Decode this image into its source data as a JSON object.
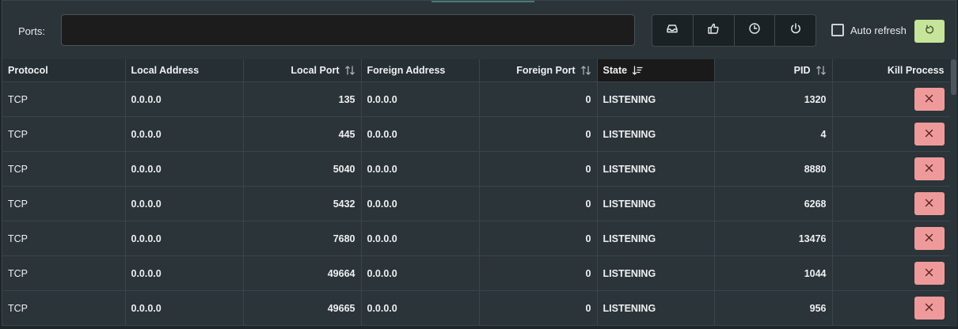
{
  "toolbar": {
    "ports_label": "Ports:",
    "ports_value": "",
    "buttons": [
      {
        "icon": "inbox-icon"
      },
      {
        "icon": "thumbs-up-icon"
      },
      {
        "icon": "clock-icon"
      },
      {
        "icon": "power-icon"
      }
    ],
    "auto_refresh_label": "Auto refresh",
    "auto_refresh_checked": false,
    "refresh_icon": "refresh-icon",
    "refresh_color": "#c6e59a"
  },
  "table": {
    "columns": [
      {
        "label": "Protocol",
        "sortable": false
      },
      {
        "label": "Local Address",
        "sortable": false
      },
      {
        "label": "Local Port",
        "sortable": true
      },
      {
        "label": "Foreign Address",
        "sortable": false
      },
      {
        "label": "Foreign Port",
        "sortable": true
      },
      {
        "label": "State",
        "sortable": true,
        "sorted": "descending"
      },
      {
        "label": "PID",
        "sortable": true
      },
      {
        "label": "Kill Process",
        "sortable": false
      }
    ],
    "rows": [
      {
        "protocol": "TCP",
        "local_address": "0.0.0.0",
        "local_port": "135",
        "foreign_address": "0.0.0.0",
        "foreign_port": "0",
        "state": "LISTENING",
        "pid": "1320"
      },
      {
        "protocol": "TCP",
        "local_address": "0.0.0.0",
        "local_port": "445",
        "foreign_address": "0.0.0.0",
        "foreign_port": "0",
        "state": "LISTENING",
        "pid": "4"
      },
      {
        "protocol": "TCP",
        "local_address": "0.0.0.0",
        "local_port": "5040",
        "foreign_address": "0.0.0.0",
        "foreign_port": "0",
        "state": "LISTENING",
        "pid": "8880"
      },
      {
        "protocol": "TCP",
        "local_address": "0.0.0.0",
        "local_port": "5432",
        "foreign_address": "0.0.0.0",
        "foreign_port": "0",
        "state": "LISTENING",
        "pid": "6268"
      },
      {
        "protocol": "TCP",
        "local_address": "0.0.0.0",
        "local_port": "7680",
        "foreign_address": "0.0.0.0",
        "foreign_port": "0",
        "state": "LISTENING",
        "pid": "13476"
      },
      {
        "protocol": "TCP",
        "local_address": "0.0.0.0",
        "local_port": "49664",
        "foreign_address": "0.0.0.0",
        "foreign_port": "0",
        "state": "LISTENING",
        "pid": "1044"
      },
      {
        "protocol": "TCP",
        "local_address": "0.0.0.0",
        "local_port": "49665",
        "foreign_address": "0.0.0.0",
        "foreign_port": "0",
        "state": "LISTENING",
        "pid": "956"
      }
    ],
    "kill_icon": "close-icon",
    "kill_color": "#ef9a9a"
  }
}
